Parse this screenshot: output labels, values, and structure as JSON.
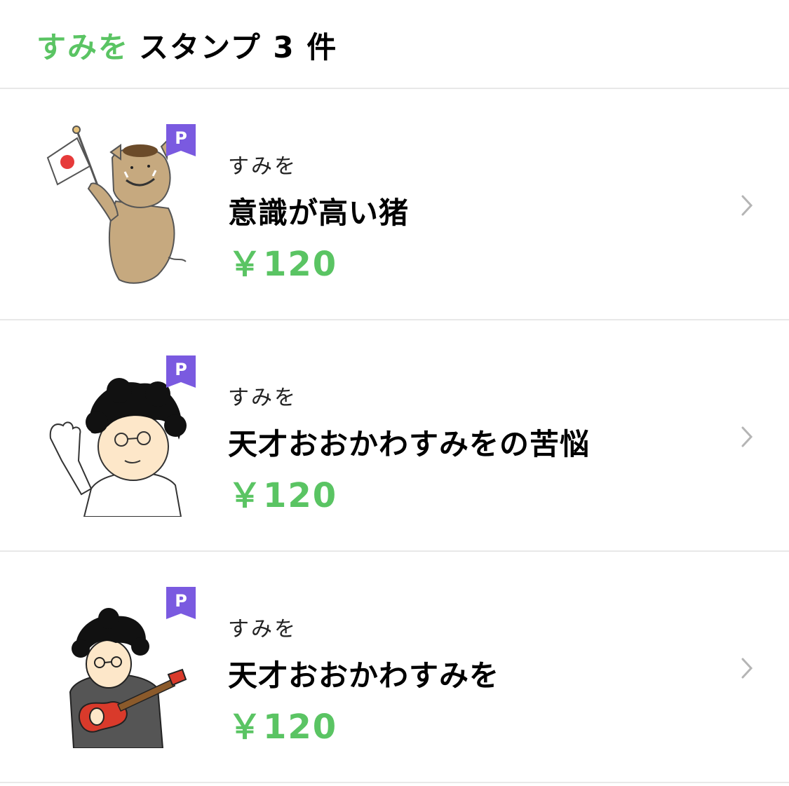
{
  "header": {
    "author": "すみを",
    "label": "スタンプ 3 件"
  },
  "badge_label": "P",
  "colors": {
    "accent_green": "#5ac463",
    "badge_purple": "#7a5ae0",
    "divider": "#e8e8e8"
  },
  "items": [
    {
      "creator": "すみを",
      "title": "意識が高い猪",
      "price": "￥120",
      "thumb": "boar-with-japan-flag"
    },
    {
      "creator": "すみを",
      "title": "天才おおかわすみをの苦悩",
      "price": "￥120",
      "thumb": "curly-hair-man-waving"
    },
    {
      "creator": "すみを",
      "title": "天才おおかわすみを",
      "price": "￥120",
      "thumb": "curly-hair-man-guitar"
    }
  ]
}
